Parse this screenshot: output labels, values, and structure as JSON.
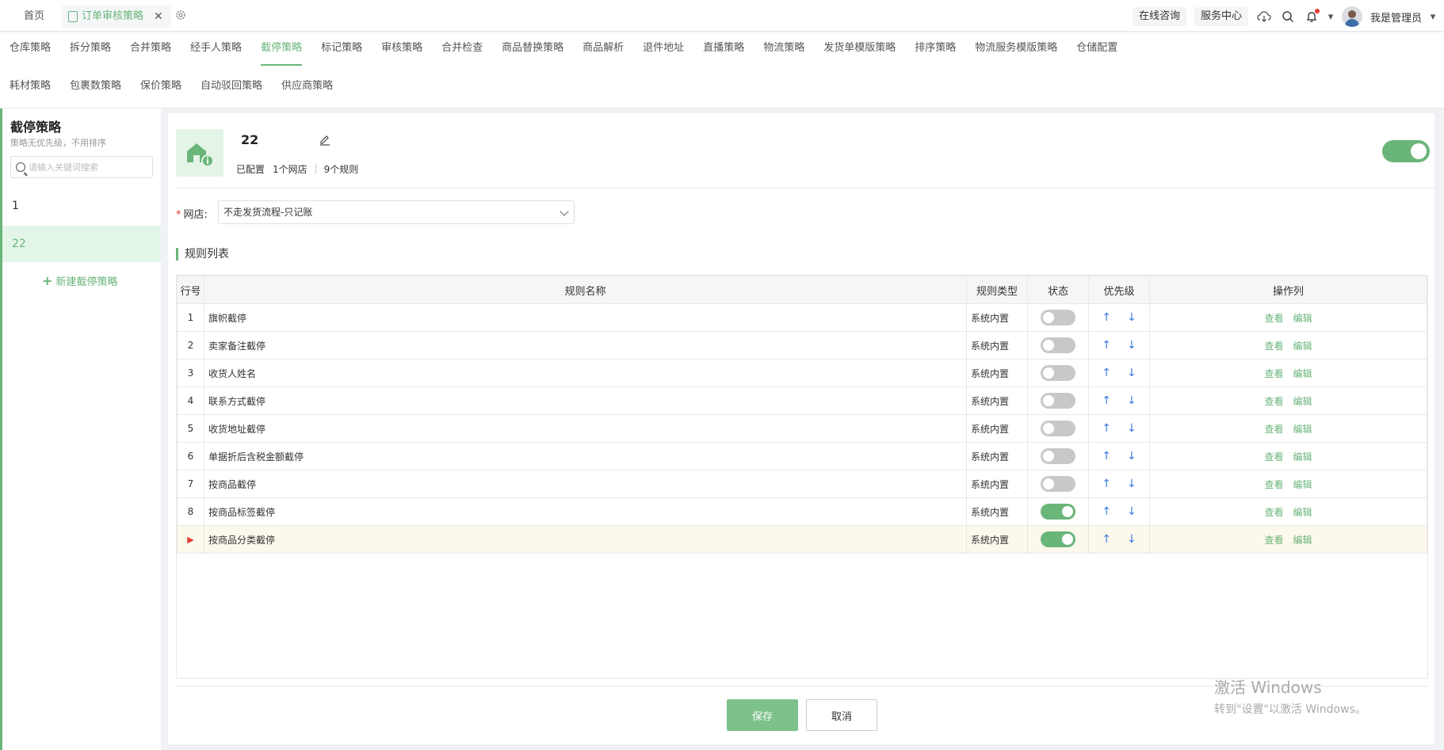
{
  "topbar": {
    "home_tab": "首页",
    "active_tab": "订单审核策略",
    "close_glyph": "✕",
    "online_consult": "在线咨询",
    "service_center": "服务中心",
    "user_name": "我是管理员"
  },
  "nav": {
    "row1": [
      "仓库策略",
      "拆分策略",
      "合并策略",
      "经手人策略",
      "截停策略",
      "标记策略",
      "审核策略",
      "合并检查",
      "商品替换策略",
      "商品解析",
      "退件地址",
      "直播策略",
      "物流策略",
      "发货单模版策略",
      "排序策略",
      "物流服务模版策略",
      "仓储配置"
    ],
    "row2": [
      "耗材策略",
      "包裹数策略",
      "保价策略",
      "自动驳回策略",
      "供应商策略"
    ],
    "active": "截停策略"
  },
  "sidebar": {
    "title": "截停策略",
    "subtitle": "策略无优先级，不用排序",
    "search_placeholder": "请输入关键词搜索",
    "items": [
      "1",
      "22"
    ],
    "new_label": "新建截停策略"
  },
  "detail": {
    "name": "22",
    "status": "已配置",
    "stores": "1个网店",
    "rules": "9个规则",
    "store_label": "网店:",
    "store_value": "不走发货流程-只记账",
    "list_title": "规则列表"
  },
  "table": {
    "headers": [
      "行号",
      "规则名称",
      "规则类型",
      "状态",
      "优先级",
      "操作列"
    ],
    "rows": [
      {
        "no": "1",
        "name": "旗帜截停",
        "type": "系统内置",
        "enabled": false
      },
      {
        "no": "2",
        "name": "卖家备注截停",
        "type": "系统内置",
        "enabled": false
      },
      {
        "no": "3",
        "name": "收货人姓名",
        "type": "系统内置",
        "enabled": false
      },
      {
        "no": "4",
        "name": "联系方式截停",
        "type": "系统内置",
        "enabled": false
      },
      {
        "no": "5",
        "name": "收货地址截停",
        "type": "系统内置",
        "enabled": false
      },
      {
        "no": "6",
        "name": "单据折后含税金额截停",
        "type": "系统内置",
        "enabled": false
      },
      {
        "no": "7",
        "name": "按商品截停",
        "type": "系统内置",
        "enabled": false
      },
      {
        "no": "8",
        "name": "按商品标签截停",
        "type": "系统内置",
        "enabled": true
      },
      {
        "no": "▶",
        "name": "按商品分类截停",
        "type": "系统内置",
        "enabled": true
      }
    ],
    "view_label": "查看",
    "edit_label": "编辑"
  },
  "buttons": {
    "save": "保存",
    "cancel": "取消"
  },
  "watermark": {
    "line1": "激活 Windows",
    "line2": "转到\"设置\"以激活 Windows。"
  },
  "colors": {
    "accent": "#6ab57a",
    "link_blue": "#3a7be0",
    "red": "#e53935"
  }
}
